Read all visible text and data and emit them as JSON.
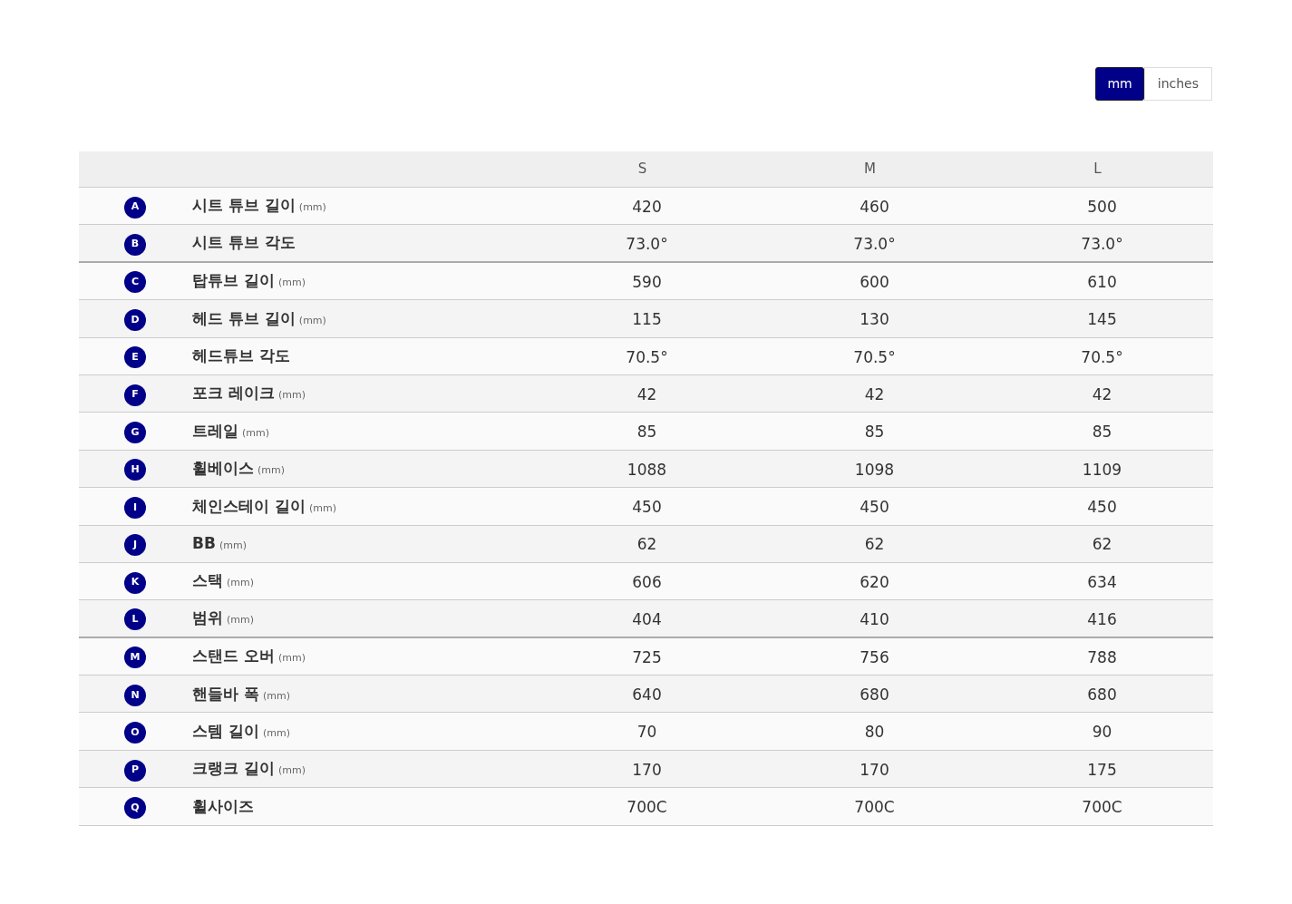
{
  "unit_toggle": [
    {
      "label": "mm",
      "selected": true
    },
    {
      "label": "inches",
      "selected": false
    }
  ],
  "table": {
    "columns": [
      "S",
      "M",
      "L"
    ],
    "rows": [
      {
        "letter": "A",
        "label": "시트 튜브 길이",
        "unit": "(mm)",
        "values": [
          "420",
          "460",
          "500"
        ],
        "separator_after": false
      },
      {
        "letter": "B",
        "label": "시트 튜브 각도",
        "values": [
          "73.0°",
          "73.0°",
          "73.0°"
        ],
        "separator_after": true
      },
      {
        "letter": "C",
        "label": "탑튜브 길이",
        "unit": "(mm)",
        "values": [
          "590",
          "600",
          "610"
        ],
        "separator_after": false
      },
      {
        "letter": "D",
        "label": "헤드 튜브 길이",
        "unit": "(mm)",
        "values": [
          "115",
          "130",
          "145"
        ],
        "separator_after": false
      },
      {
        "letter": "E",
        "label": "헤드튜브 각도",
        "values": [
          "70.5°",
          "70.5°",
          "70.5°"
        ],
        "separator_after": false
      },
      {
        "letter": "F",
        "label": "포크 레이크",
        "unit": "(mm)",
        "values": [
          "42",
          "42",
          "42"
        ],
        "separator_after": false
      },
      {
        "letter": "G",
        "label": "트레일",
        "unit": "(mm)",
        "values": [
          "85",
          "85",
          "85"
        ],
        "separator_after": false
      },
      {
        "letter": "H",
        "label": "휠베이스",
        "unit": "(mm)",
        "values": [
          "1088",
          "1098",
          "1109"
        ],
        "separator_after": false
      },
      {
        "letter": "I",
        "label": "체인스테이 길이",
        "unit": "(mm)",
        "values": [
          "450",
          "450",
          "450"
        ],
        "separator_after": false
      },
      {
        "letter": "J",
        "label": "BB",
        "unit": "(mm)",
        "values": [
          "62",
          "62",
          "62"
        ],
        "separator_after": false
      },
      {
        "letter": "K",
        "label": "스택",
        "unit": "(mm)",
        "values": [
          "606",
          "620",
          "634"
        ],
        "separator_after": false
      },
      {
        "letter": "L",
        "label": "범위",
        "unit": "(mm)",
        "values": [
          "404",
          "410",
          "416"
        ],
        "separator_after": true
      },
      {
        "letter": "M",
        "label": "스탠드 오버",
        "unit": "(mm)",
        "values": [
          "725",
          "756",
          "788"
        ],
        "separator_after": false
      },
      {
        "letter": "N",
        "label": "핸들바 폭",
        "unit": "(mm)",
        "values": [
          "640",
          "680",
          "680"
        ],
        "separator_after": false
      },
      {
        "letter": "O",
        "label": "스템 길이",
        "unit": "(mm)",
        "values": [
          "70",
          "80",
          "90"
        ],
        "separator_after": false
      },
      {
        "letter": "P",
        "label": "크랭크 길이",
        "unit": "(mm)",
        "values": [
          "170",
          "170",
          "175"
        ],
        "separator_after": false
      },
      {
        "letter": "Q",
        "label": "휠사이즈",
        "values": [
          "700C",
          "700C",
          "700C"
        ],
        "separator_after": false
      }
    ]
  }
}
